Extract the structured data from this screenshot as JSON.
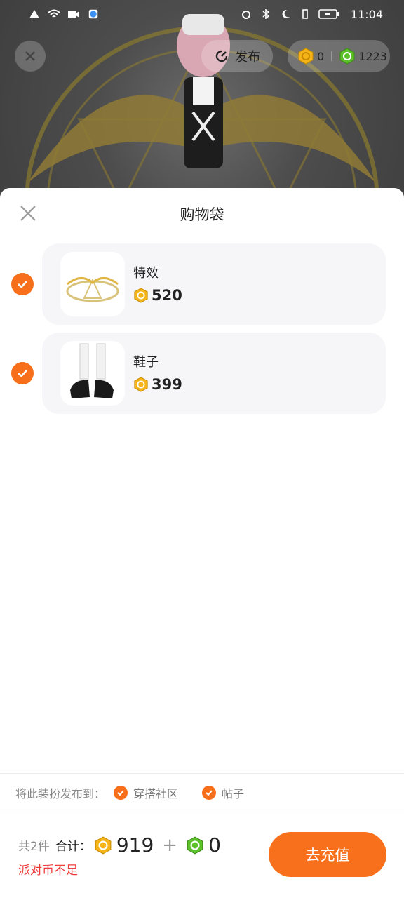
{
  "status_bar": {
    "time": "11:04"
  },
  "top": {
    "publish_label": "发布",
    "currency_gold": "0",
    "currency_green": "1223"
  },
  "sheet": {
    "title": "购物袋",
    "items": [
      {
        "name": "特效",
        "price": "520",
        "checked": true
      },
      {
        "name": "鞋子",
        "price": "399",
        "checked": true
      }
    ],
    "publish_to_label": "将此装扮发布到：",
    "publish_options": [
      {
        "label": "穿搭社区",
        "checked": true
      },
      {
        "label": "帖子",
        "checked": true
      }
    ]
  },
  "footer": {
    "count_text": "共2件",
    "total_label": "合计：",
    "gold_total": "919",
    "plus": "+",
    "green_total": "0",
    "insufficient_text": "派对币不足",
    "recharge_label": "去充值"
  },
  "colors": {
    "accent_orange": "#f86f1b",
    "error_red": "#ef3b3b",
    "gold_coin": "#f5b417",
    "green_coin": "#5cc12b"
  }
}
